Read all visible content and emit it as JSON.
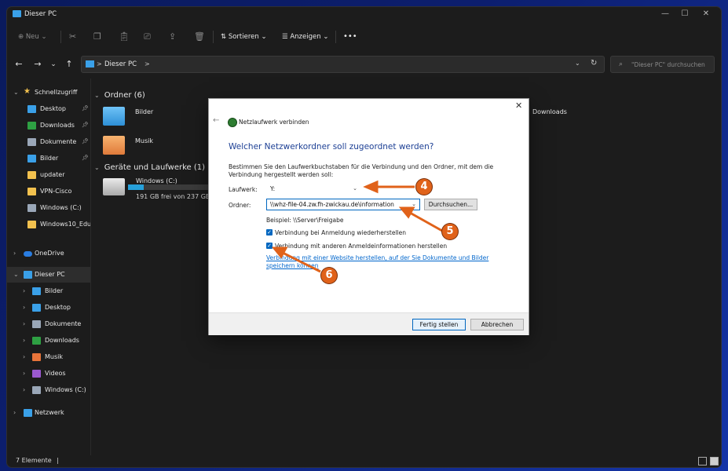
{
  "window": {
    "title": "Dieser PC",
    "controls": {
      "minimize": "—",
      "maximize": "☐",
      "close": "✕"
    }
  },
  "commandbar": {
    "new_label": "Neu",
    "sort_label": "Sortieren",
    "view_label": "Anzeigen",
    "more_label": "•••"
  },
  "address": {
    "path_root": "Dieser PC",
    "separator": ">",
    "search_placeholder": "\"Dieser PC\" durchsuchen"
  },
  "sidebar": {
    "quick_access": "Schnellzugriff",
    "quick_items": [
      {
        "label": "Desktop",
        "pinned": true,
        "color": "#3aa0e8"
      },
      {
        "label": "Downloads",
        "pinned": true,
        "color": "#2ea043"
      },
      {
        "label": "Dokumente",
        "pinned": true,
        "color": "#9aa7b8"
      },
      {
        "label": "Bilder",
        "pinned": true,
        "color": "#3aa0e8"
      },
      {
        "label": "updater",
        "pinned": false,
        "color": "#f2c14e"
      },
      {
        "label": "VPN-Cisco",
        "pinned": false,
        "color": "#f2c14e"
      },
      {
        "label": "Windows (C:)",
        "pinned": false,
        "color": "#9aa7b8"
      },
      {
        "label": "Windows10_Edu",
        "pinned": false,
        "color": "#f2c14e"
      }
    ],
    "onedrive": "OneDrive",
    "this_pc": "Dieser PC",
    "pc_items": [
      {
        "label": "Bilder",
        "color": "#3aa0e8"
      },
      {
        "label": "Desktop",
        "color": "#3aa0e8"
      },
      {
        "label": "Dokumente",
        "color": "#9aa7b8"
      },
      {
        "label": "Downloads",
        "color": "#2ea043"
      },
      {
        "label": "Musik",
        "color": "#e8743a"
      },
      {
        "label": "Videos",
        "color": "#9b59d0"
      },
      {
        "label": "Windows (C:)",
        "color": "#9aa7b8"
      }
    ],
    "network": "Netzwerk"
  },
  "content": {
    "folders_group": "Ordner",
    "folders_count": "(6)",
    "folder_bilder": "Bilder",
    "folder_musik": "Musik",
    "folder_downloads": "Downloads",
    "drives_group": "Geräte und Laufwerke",
    "drives_count": "(1)",
    "drive_name": "Windows (C:)",
    "drive_free": "191 GB frei von 237 GB",
    "drive_used_fraction": 0.19
  },
  "status": {
    "items": "7 Elemente",
    "cursor": "|"
  },
  "dialog": {
    "title": "Netzlaufwerk verbinden",
    "heading": "Welcher Netzwerkordner soll zugeordnet werden?",
    "description": "Bestimmen Sie den Laufwerkbuchstaben für die Verbindung und den Ordner, mit dem die Verbindung hergestellt werden soll:",
    "drive_label": "Laufwerk:",
    "drive_value": "Y:",
    "folder_label": "Ordner:",
    "folder_value": "\\\\whz-file-04.zw.fh-zwickau.de\\information",
    "browse_button": "Durchsuchen...",
    "example": "Beispiel: \\\\Server\\Freigabe",
    "reconnect_label": "Verbindung bei Anmeldung wiederherstellen",
    "reconnect_checked": true,
    "credentials_label": "Verbindung mit anderen Anmeldeinformationen herstellen",
    "credentials_checked": true,
    "link_text": "Verbindung mit einer Website herstellen, auf der Sie Dokumente und Bilder speichern können",
    "finish_button": "Fertig stellen",
    "cancel_button": "Abbrechen",
    "close_glyph": "✕",
    "back_glyph": "←"
  },
  "annotations": {
    "marker_drive": "4",
    "marker_folder": "5",
    "marker_credentials": "6",
    "color": "#e0621a"
  },
  "colors": {
    "accent": "#0067c0",
    "heading": "#1c3f94",
    "window_bg": "#1c1c1c"
  }
}
